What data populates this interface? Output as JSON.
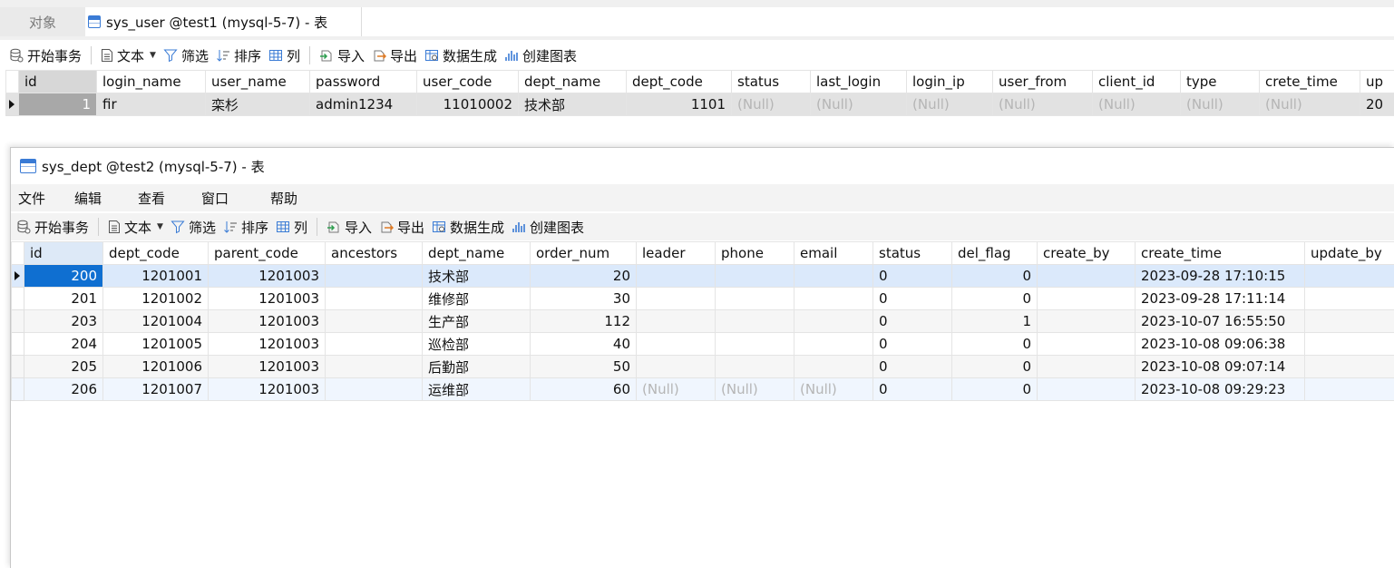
{
  "tabs": {
    "objects": "对象",
    "active": "sys_user @test1 (mysql-5-7) - 表"
  },
  "toolbar": {
    "begin_tx": "开始事务",
    "text": "文本",
    "filter": "筛选",
    "sort": "排序",
    "columns": "列",
    "import": "导入",
    "export": "导出",
    "data_gen": "数据生成",
    "chart": "创建图表"
  },
  "user_grid": {
    "headers": [
      "id",
      "login_name",
      "user_name",
      "password",
      "user_code",
      "dept_name",
      "dept_code",
      "status",
      "last_login",
      "login_ip",
      "user_from",
      "client_id",
      "type",
      "crete_time",
      "up"
    ],
    "row": [
      "1",
      "fir",
      "栾杉",
      "admin1234",
      "11010002",
      "技术部",
      "1101",
      "(Null)",
      "(Null)",
      "(Null)",
      "(Null)",
      "(Null)",
      "(Null)",
      "(Null)",
      "20"
    ]
  },
  "dept_window": {
    "title": "sys_dept @test2 (mysql-5-7) - 表",
    "menu": [
      "文件",
      "编辑",
      "查看",
      "窗口",
      "帮助"
    ],
    "headers": [
      "id",
      "dept_code",
      "parent_code",
      "ancestors",
      "dept_name",
      "order_num",
      "leader",
      "phone",
      "email",
      "status",
      "del_flag",
      "create_by",
      "create_time",
      "update_by"
    ],
    "rows": [
      [
        "200",
        "1201001",
        "1201003",
        "",
        "技术部",
        "20",
        "",
        "",
        "",
        "0",
        "0",
        "",
        "2023-09-28 17:10:15",
        ""
      ],
      [
        "201",
        "1201002",
        "1201003",
        "",
        "维修部",
        "30",
        "",
        "",
        "",
        "0",
        "0",
        "",
        "2023-09-28 17:11:14",
        ""
      ],
      [
        "203",
        "1201004",
        "1201003",
        "",
        "生产部",
        "112",
        "",
        "",
        "",
        "0",
        "1",
        "",
        "2023-10-07 16:55:50",
        ""
      ],
      [
        "204",
        "1201005",
        "1201003",
        "",
        "巡检部",
        "40",
        "",
        "",
        "",
        "0",
        "0",
        "",
        "2023-10-08 09:06:38",
        ""
      ],
      [
        "205",
        "1201006",
        "1201003",
        "",
        "后勤部",
        "50",
        "",
        "",
        "",
        "0",
        "0",
        "",
        "2023-10-08 09:07:14",
        ""
      ],
      [
        "206",
        "1201007",
        "1201003",
        "",
        "运维部",
        "60",
        "(Null)",
        "(Null)",
        "(Null)",
        "0",
        "0",
        "",
        "2023-10-08 09:29:23",
        ""
      ]
    ]
  },
  "colors": {
    "accent": "#0f6fd1",
    "null_text": "#b5b5b5"
  }
}
